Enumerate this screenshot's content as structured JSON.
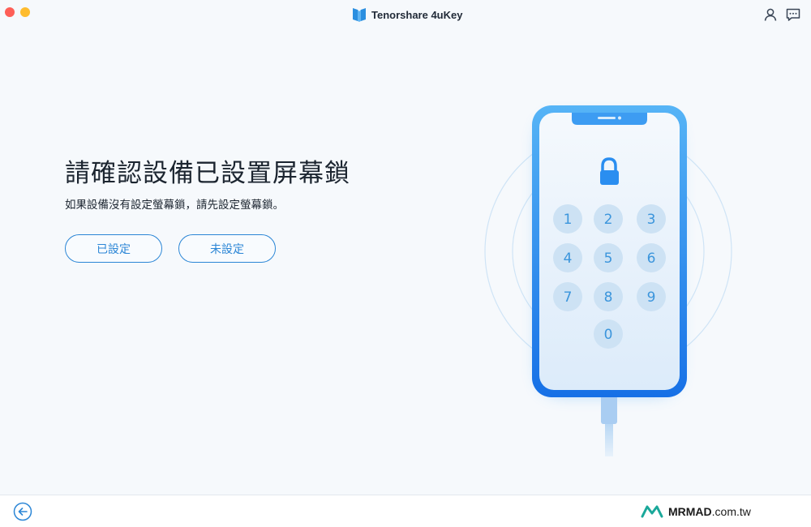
{
  "window": {
    "app_name": "Tenorshare 4uKey"
  },
  "header": {
    "icons": [
      "user-icon",
      "feedback-icon"
    ]
  },
  "main": {
    "heading": "請確認設備已設置屏幕鎖",
    "subtext": "如果設備沒有設定螢幕鎖，請先設定螢幕鎖。",
    "buttons": {
      "set_label": "已設定",
      "not_set_label": "未設定"
    }
  },
  "illustration": {
    "keypad": [
      "1",
      "2",
      "3",
      "4",
      "5",
      "6",
      "7",
      "8",
      "9",
      "0"
    ]
  },
  "footer": {
    "watermark_brand": "MRMAD",
    "watermark_domain": ".com.tw"
  },
  "colors": {
    "accent": "#2b86d6",
    "phone_blue": "#1f7fe8",
    "close": "#fe5f57",
    "minimize": "#febc2e"
  }
}
